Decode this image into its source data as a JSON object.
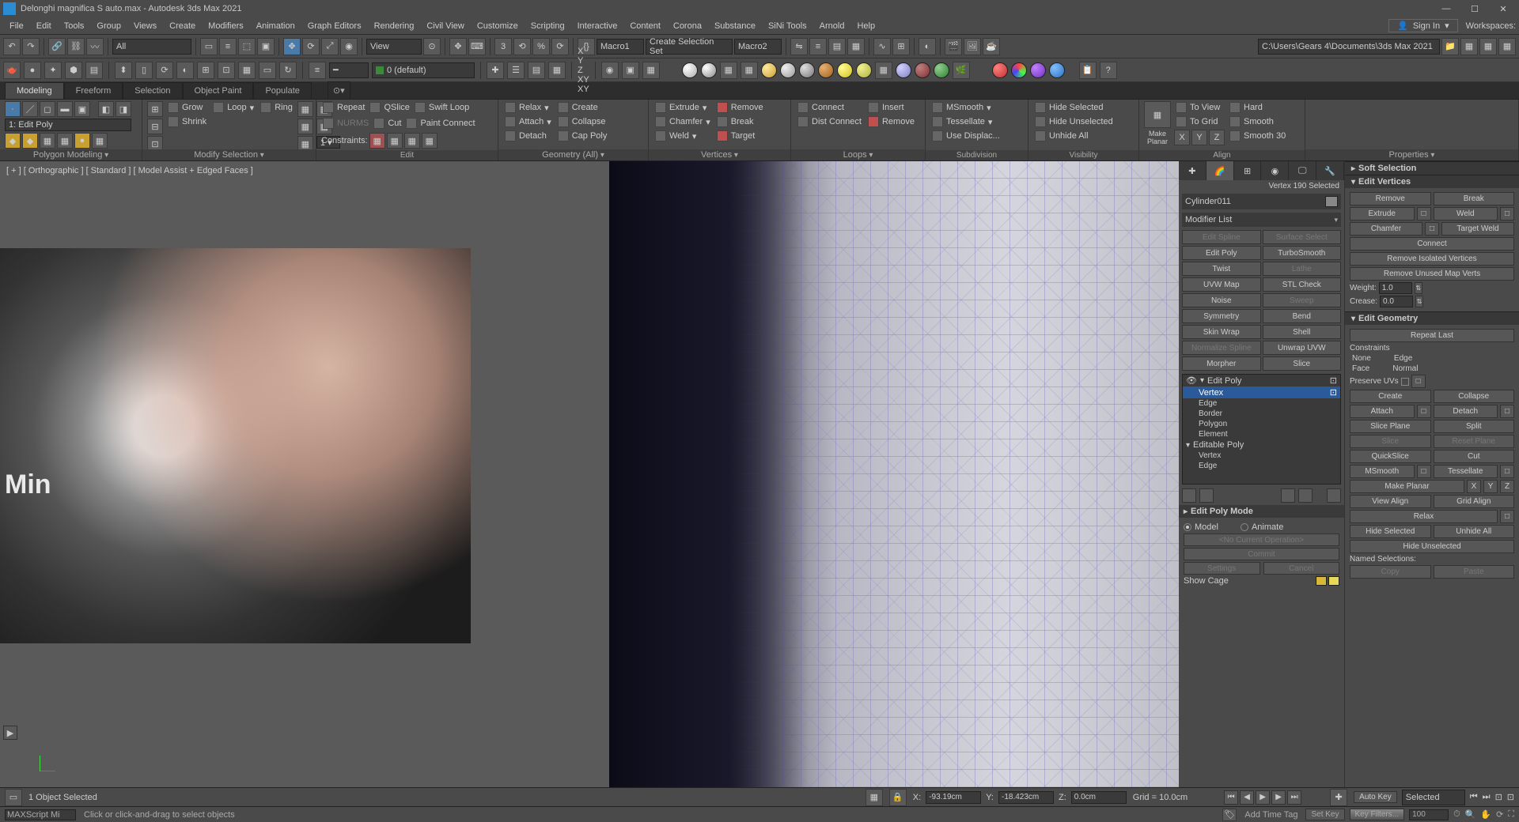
{
  "window": {
    "title": "Delonghi magnifica S auto.max - Autodesk 3ds Max 2021",
    "sign_in": "Sign In",
    "workspaces": "Workspaces:"
  },
  "menu": [
    "File",
    "Edit",
    "Tools",
    "Group",
    "Views",
    "Create",
    "Modifiers",
    "Animation",
    "Graph Editors",
    "Rendering",
    "Civil View",
    "Customize",
    "Scripting",
    "Interactive",
    "Content",
    "Corona",
    "Substance",
    "SiNi Tools",
    "Arnold",
    "Help"
  ],
  "toolbar": {
    "all_filter": "All",
    "view": "View",
    "create_sel_set": "Create Selection Set",
    "macro1": "Macro1",
    "macro2": "Macro2",
    "path": "C:\\Users\\Gears 4\\Documents\\3ds Max 2021",
    "axes": [
      "X",
      "Y",
      "Z",
      "XY",
      "XY"
    ],
    "mat_default": "0 (default)"
  },
  "ribbon": {
    "tabs": [
      "Modeling",
      "Freeform",
      "Selection",
      "Object Paint",
      "Populate"
    ],
    "poly_mode_label": "1: Edit Poly",
    "panels": {
      "polygon_modeling": "Polygon Modeling",
      "modify_selection": "Modify Selection",
      "edit": "Edit",
      "geometry_all": "Geometry (All)",
      "vertices": "Vertices",
      "loops": "Loops",
      "subdivision": "Subdivision",
      "visibility": "Visibility",
      "align": "Align",
      "properties": "Properties"
    },
    "modify_selection": {
      "grow": "Grow",
      "shrink": "Shrink",
      "loop": "Loop",
      "ring": "Ring"
    },
    "edit": {
      "repeat": "Repeat",
      "qslice": "QSlice",
      "swiftloop": "Swift Loop",
      "nurms": "NURMS",
      "cut": "Cut",
      "paintconnect": "Paint Connect",
      "constraints": "Constraints:"
    },
    "geometry": {
      "relax": "Relax",
      "create": "Create",
      "attach": "Attach",
      "collapse": "Collapse",
      "detach": "Detach",
      "cappoly": "Cap Poly"
    },
    "vertices": {
      "extrude": "Extrude",
      "remove": "Remove",
      "chamfer": "Chamfer",
      "break": "Break",
      "weld": "Weld",
      "target": "Target"
    },
    "loops": {
      "connect": "Connect",
      "insert": "Insert",
      "distconnect": "Dist Connect",
      "remove": "Remove"
    },
    "subdivision": {
      "msmooth": "MSmooth",
      "tessellate": "Tessellate",
      "usedisplace": "Use Displac..."
    },
    "visibility": {
      "hidesel": "Hide Selected",
      "hideunsel": "Hide Unselected",
      "unhideall": "Unhide All"
    },
    "align": {
      "makeplanar": "Make\nPlanar",
      "toview": "To View",
      "hard": "Hard",
      "togrid": "To Grid",
      "smooth": "Smooth",
      "xyz": [
        "X",
        "Y",
        "Z"
      ],
      "smoothn": "Smooth 30"
    }
  },
  "viewport": {
    "label": "[ + ] [ Orthographic ] [ Standard ] [ Model Assist + Edged Faces ]",
    "ref_min": "Min"
  },
  "cmdpanel": {
    "selection_info": "Vertex 190 Selected",
    "object_name": "Cylinder011",
    "modifier_list": "Modifier List",
    "mod_buttons": [
      [
        "Edit Spline",
        "Surface Select",
        true
      ],
      [
        "Edit Poly",
        "TurboSmooth",
        false
      ],
      [
        "Twist",
        "Lathe",
        false
      ],
      [
        "UVW Map",
        "STL Check",
        false
      ],
      [
        "Noise",
        "Sweep",
        false
      ],
      [
        "Symmetry",
        "Bend",
        false
      ],
      [
        "Skin Wrap",
        "Shell",
        false
      ],
      [
        "Normalize Spline",
        "Unwrap UVW",
        false
      ],
      [
        "Morpher",
        "Slice",
        false
      ]
    ],
    "stack": [
      {
        "label": "Edit Poly",
        "lvl": 0,
        "sel": false,
        "exp": true
      },
      {
        "label": "Vertex",
        "lvl": 1,
        "sel": true
      },
      {
        "label": "Edge",
        "lvl": 1,
        "sel": false
      },
      {
        "label": "Border",
        "lvl": 1,
        "sel": false
      },
      {
        "label": "Polygon",
        "lvl": 1,
        "sel": false
      },
      {
        "label": "Element",
        "lvl": 1,
        "sel": false
      },
      {
        "label": "Editable Poly",
        "lvl": 0,
        "sel": false,
        "exp": true
      },
      {
        "label": "Vertex",
        "lvl": 1,
        "sel": false
      },
      {
        "label": "Edge",
        "lvl": 1,
        "sel": false
      }
    ],
    "edit_poly_mode": {
      "title": "Edit Poly Mode",
      "model": "Model",
      "animate": "Animate",
      "no_op": "<No Current Operation>",
      "commit": "Commit",
      "settings": "Settings",
      "cancel": "Cancel",
      "show_cage": "Show Cage"
    }
  },
  "rollouts": {
    "soft_selection": "Soft Selection",
    "edit_vertices": {
      "title": "Edit Vertices",
      "remove": "Remove",
      "break": "Break",
      "extrude": "Extrude",
      "weld": "Weld",
      "chamfer": "Chamfer",
      "targetweld": "Target Weld",
      "connect": "Connect",
      "rem_iso": "Remove Isolated Vertices",
      "rem_unused": "Remove Unused Map Verts",
      "weight": "Weight:",
      "weight_v": "1.0",
      "crease": "Crease:",
      "crease_v": "0.0"
    },
    "edit_geometry": {
      "title": "Edit Geometry",
      "repeat_last": "Repeat Last",
      "constraints": "Constraints",
      "none": "None",
      "edge": "Edge",
      "face": "Face",
      "normal": "Normal",
      "preserve_uvs": "Preserve UVs",
      "create": "Create",
      "collapse": "Collapse",
      "attach": "Attach",
      "detach": "Detach",
      "slice_plane": "Slice Plane",
      "split": "Split",
      "slice": "Slice",
      "reset_plane": "Reset Plane",
      "quickslice": "QuickSlice",
      "cut": "Cut",
      "msmooth": "MSmooth",
      "tessellate": "Tessellate",
      "make_planar": "Make Planar",
      "x": "X",
      "y": "Y",
      "z": "Z",
      "view_align": "View Align",
      "grid_align": "Grid Align",
      "relax": "Relax",
      "hide_sel": "Hide Selected",
      "unhide_all": "Unhide All",
      "hide_unsel": "Hide Unselected",
      "named_sel": "Named Selections:",
      "copy": "Copy",
      "paste": "Paste"
    }
  },
  "status": {
    "obj_sel": "1 Object Selected",
    "prompt": "Click or click-and-drag to select objects",
    "maxscript": "MAXScript Mi",
    "coords": {
      "x": "X:",
      "xv": "-93.19cm",
      "y": "Y:",
      "yv": "-18.423cm",
      "z": "Z:",
      "zv": "0.0cm"
    },
    "grid": "Grid = 10.0cm",
    "add_time_tag": "Add Time Tag",
    "auto_key": "Auto Key",
    "set_key": "Set Key",
    "selected": "Selected",
    "key_filters": "Key Filters...",
    "frame": "100"
  }
}
